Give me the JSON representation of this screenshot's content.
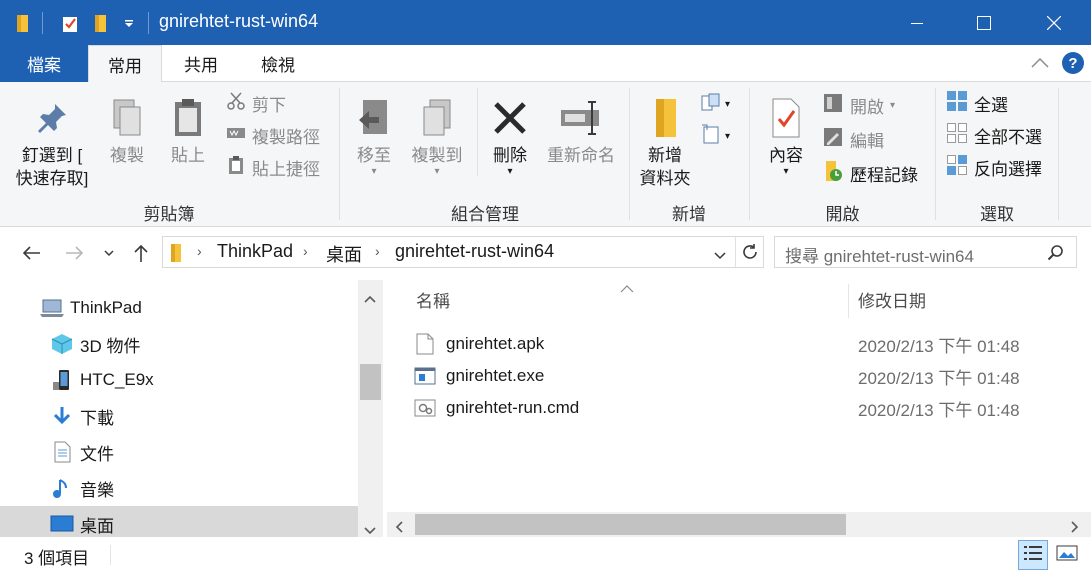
{
  "window": {
    "title": "gnirehtet-rust-win64"
  },
  "tabs": [
    {
      "label": "檔案"
    },
    {
      "label": "常用"
    },
    {
      "label": "共用"
    },
    {
      "label": "檢視"
    }
  ],
  "ribbon": {
    "clipboard": {
      "pin_line1": "釘選到 [",
      "pin_line2": "快速存取]",
      "copy": "複製",
      "paste": "貼上",
      "cut": "剪下",
      "copy_path": "複製路徑",
      "paste_shortcut": "貼上捷徑",
      "label": "剪貼簿"
    },
    "organize": {
      "move_to": "移至",
      "copy_to": "複製到",
      "delete": "刪除",
      "rename": "重新命名",
      "label": "組合管理"
    },
    "new": {
      "new_folder_line1": "新增",
      "new_folder_line2": "資料夾",
      "label": "新增"
    },
    "open": {
      "properties": "內容",
      "open": "開啟",
      "edit": "編輯",
      "history": "歷程記錄",
      "label": "開啟"
    },
    "select": {
      "select_all": "全選",
      "select_none": "全部不選",
      "invert": "反向選擇",
      "label": "選取"
    }
  },
  "address": {
    "crumbs": [
      "ThinkPad",
      "桌面",
      "gnirehtet-rust-win64"
    ],
    "search_placeholder": "搜尋 gnirehtet-rust-win64"
  },
  "nav": {
    "items": [
      {
        "label": "ThinkPad",
        "icon": "computer-icon"
      },
      {
        "label": "3D 物件",
        "icon": "3d-objects-icon"
      },
      {
        "label": "HTC_E9x",
        "icon": "phone-icon"
      },
      {
        "label": "下載",
        "icon": "download-icon"
      },
      {
        "label": "文件",
        "icon": "document-icon"
      },
      {
        "label": "音樂",
        "icon": "music-icon"
      },
      {
        "label": "桌面",
        "icon": "desktop-icon",
        "selected": true
      }
    ]
  },
  "files": {
    "columns": {
      "name": "名稱",
      "date": "修改日期"
    },
    "rows": [
      {
        "name": "gnirehtet.apk",
        "date": "2020/2/13 下午 01:48",
        "icon": "file-icon"
      },
      {
        "name": "gnirehtet.exe",
        "date": "2020/2/13 下午 01:48",
        "icon": "exe-icon"
      },
      {
        "name": "gnirehtet-run.cmd",
        "date": "2020/2/13 下午 01:48",
        "icon": "cmd-icon"
      }
    ]
  },
  "status": {
    "count": "3 個項目"
  },
  "colors": {
    "titlebar": "#1e61b3",
    "selected": "#cce8ff",
    "nav_selected": "#d9d9d9"
  }
}
